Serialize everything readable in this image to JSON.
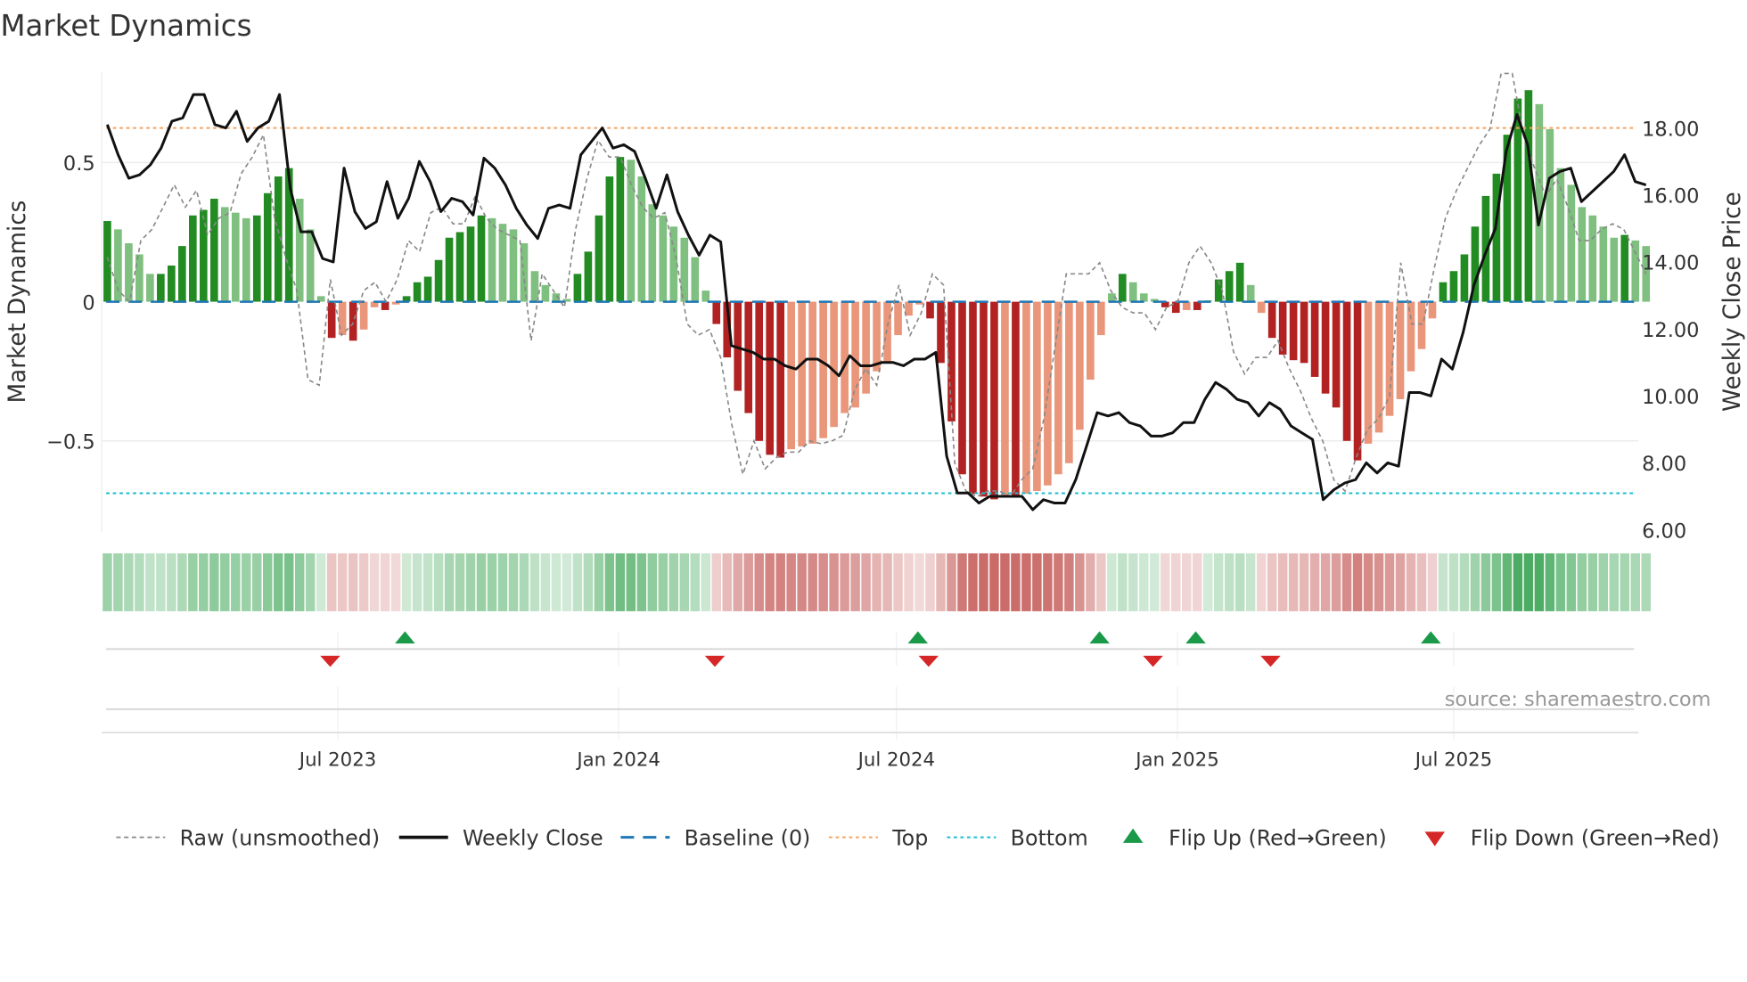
{
  "chart_data": {
    "type": "bar",
    "title": "Market Dynamics",
    "ylabel": "Market Dynamics",
    "y2label": "Weekly Close Price",
    "first_week": "2023-01-31",
    "ylim": [
      -0.828,
      0.824
    ],
    "y2lim": [
      5.93,
      19.66
    ],
    "yticks": [
      {
        "v": 0.5,
        "label": "0.5"
      },
      {
        "v": 0,
        "label": "0"
      },
      {
        "v": -0.5,
        "label": "−0.5"
      }
    ],
    "y2ticks": [
      {
        "v": 18,
        "label": "18.00"
      },
      {
        "v": 16,
        "label": "16.00"
      },
      {
        "v": 14,
        "label": "14.00"
      },
      {
        "v": 12,
        "label": "12.00"
      },
      {
        "v": 10,
        "label": "10.00"
      },
      {
        "v": 8,
        "label": "8.00"
      },
      {
        "v": 6,
        "label": "6.00"
      }
    ],
    "xticks": [
      {
        "date": "2023-07-01",
        "label": "Jul 2023"
      },
      {
        "date": "2024-01-01",
        "label": "Jan 2024"
      },
      {
        "date": "2024-07-01",
        "label": "Jul 2024"
      },
      {
        "date": "2025-01-01",
        "label": "Jan 2025"
      },
      {
        "date": "2025-07-01",
        "label": "Jul 2025"
      }
    ],
    "top_level": 0.624,
    "bottom_level": -0.688,
    "baseline": 0,
    "histogram": [
      0.29,
      0.26,
      0.21,
      0.17,
      0.1,
      0.1,
      0.13,
      0.2,
      0.31,
      0.33,
      0.37,
      0.34,
      0.32,
      0.3,
      0.31,
      0.39,
      0.45,
      0.48,
      0.37,
      0.26,
      0.02,
      -0.13,
      -0.12,
      -0.14,
      -0.1,
      -0.02,
      -0.03,
      -0.01,
      0.02,
      0.07,
      0.09,
      0.15,
      0.23,
      0.25,
      0.27,
      0.31,
      0.3,
      0.28,
      0.26,
      0.21,
      0.11,
      0.06,
      0.03,
      0.01,
      0.1,
      0.18,
      0.31,
      0.45,
      0.52,
      0.51,
      0.45,
      0.35,
      0.31,
      0.27,
      0.23,
      0.16,
      0.04,
      -0.08,
      -0.2,
      -0.32,
      -0.4,
      -0.5,
      -0.55,
      -0.56,
      -0.53,
      -0.52,
      -0.51,
      -0.49,
      -0.45,
      -0.4,
      -0.38,
      -0.33,
      -0.25,
      -0.22,
      -0.12,
      -0.05,
      -0.01,
      -0.06,
      -0.22,
      -0.43,
      -0.62,
      -0.69,
      -0.7,
      -0.71,
      -0.7,
      -0.7,
      -0.69,
      -0.68,
      -0.66,
      -0.62,
      -0.58,
      -0.46,
      -0.28,
      -0.12,
      0.03,
      0.1,
      0.07,
      0.03,
      0.01,
      -0.02,
      -0.04,
      -0.03,
      -0.03,
      0.005,
      0.08,
      0.11,
      0.14,
      0.06,
      -0.04,
      -0.13,
      -0.19,
      -0.21,
      -0.22,
      -0.27,
      -0.33,
      -0.38,
      -0.5,
      -0.57,
      -0.51,
      -0.47,
      -0.41,
      -0.35,
      -0.25,
      -0.17,
      -0.06,
      0.07,
      0.11,
      0.17,
      0.27,
      0.38,
      0.46,
      0.6,
      0.73,
      0.76,
      0.71,
      0.62,
      0.48,
      0.42,
      0.34,
      0.31,
      0.27,
      0.23,
      0.24,
      0.22,
      0.2
    ],
    "raw": [
      0.16,
      0.04,
      0.0,
      0.22,
      0.26,
      0.34,
      0.42,
      0.34,
      0.4,
      0.24,
      0.3,
      0.32,
      0.46,
      0.52,
      0.6,
      0.3,
      0.16,
      0.04,
      -0.28,
      -0.3,
      0.08,
      -0.12,
      -0.08,
      0.04,
      0.07,
      0.0,
      0.08,
      0.22,
      0.18,
      0.32,
      0.34,
      0.28,
      0.28,
      0.38,
      0.3,
      0.26,
      0.24,
      0.22,
      -0.14,
      0.1,
      0.04,
      -0.02,
      0.26,
      0.44,
      0.58,
      0.52,
      0.52,
      0.42,
      0.34,
      0.3,
      0.32,
      0.16,
      -0.08,
      -0.12,
      -0.1,
      -0.2,
      -0.44,
      -0.62,
      -0.5,
      -0.6,
      -0.56,
      -0.54,
      -0.54,
      -0.5,
      -0.51,
      -0.5,
      -0.48,
      -0.32,
      -0.24,
      -0.3,
      -0.08,
      0.06,
      -0.12,
      -0.04,
      0.1,
      0.06,
      -0.58,
      -0.68,
      -0.7,
      -0.68,
      -0.68,
      -0.7,
      -0.64,
      -0.6,
      -0.42,
      -0.16,
      0.1,
      0.1,
      0.1,
      0.14,
      0.04,
      -0.02,
      -0.04,
      -0.04,
      -0.1,
      -0.02,
      0.0,
      0.14,
      0.2,
      0.14,
      0.04,
      -0.18,
      -0.26,
      -0.2,
      -0.2,
      -0.14,
      -0.24,
      -0.32,
      -0.42,
      -0.5,
      -0.64,
      -0.68,
      -0.56,
      -0.46,
      -0.42,
      -0.34,
      0.14,
      -0.08,
      -0.08,
      0.12,
      0.3,
      0.4,
      0.48,
      0.56,
      0.62,
      0.82,
      0.82,
      0.6,
      0.48,
      0.38,
      0.44,
      0.34,
      0.22,
      0.22,
      0.26,
      0.28,
      0.26,
      0.18,
      0.1
    ],
    "close": [
      18.1,
      17.2,
      16.5,
      16.6,
      16.9,
      17.4,
      18.2,
      18.3,
      19.0,
      19.0,
      18.1,
      18.0,
      18.5,
      17.6,
      18.0,
      18.2,
      19.0,
      16.2,
      14.9,
      14.9,
      14.1,
      14.0,
      16.8,
      15.5,
      15.0,
      15.2,
      16.4,
      15.3,
      15.9,
      17.0,
      16.4,
      15.5,
      15.9,
      15.8,
      15.4,
      17.1,
      16.8,
      16.3,
      15.6,
      15.1,
      14.7,
      15.6,
      15.7,
      15.6,
      17.2,
      17.6,
      18.0,
      17.4,
      17.5,
      17.3,
      16.5,
      15.6,
      16.6,
      15.5,
      14.8,
      14.2,
      14.8,
      14.6,
      11.5,
      11.4,
      11.3,
      11.1,
      11.1,
      10.9,
      10.8,
      11.1,
      11.1,
      10.9,
      10.6,
      11.2,
      10.9,
      10.9,
      11.0,
      11.0,
      10.9,
      11.1,
      11.1,
      11.3,
      8.2,
      7.1,
      7.1,
      6.8,
      7.0,
      7.0,
      7.0,
      7.0,
      6.6,
      6.9,
      6.8,
      6.8,
      7.5,
      8.5,
      9.5,
      9.4,
      9.5,
      9.2,
      9.1,
      8.8,
      8.8,
      8.9,
      9.2,
      9.2,
      9.9,
      10.4,
      10.2,
      9.9,
      9.8,
      9.4,
      9.8,
      9.6,
      9.1,
      8.9,
      8.7,
      6.9,
      7.2,
      7.4,
      7.5,
      8.0,
      7.7,
      8.0,
      7.9,
      10.1,
      10.1,
      10.0,
      11.1,
      10.8,
      11.9,
      13.3,
      14.2,
      15.0,
      17.3,
      18.4,
      17.5,
      15.1,
      16.5,
      16.7,
      16.8,
      15.8,
      16.1,
      16.4,
      16.7,
      17.2,
      16.4,
      16.3
    ],
    "flips_up": [
      "2023-08-14",
      "2024-07-15",
      "2024-11-11",
      "2025-01-13",
      "2025-06-16"
    ],
    "flips_down": [
      "2023-06-26",
      "2024-03-04",
      "2024-07-22",
      "2024-12-16",
      "2025-03-03"
    ],
    "legend": {
      "raw": "Raw (unsmoothed)",
      "close": "Weekly Close",
      "baseline": "Baseline (0)",
      "top": "Top",
      "bottom": "Bottom",
      "flip_up": "Flip Up (Red→Green)",
      "flip_down": "Flip Down (Green→Red)"
    },
    "source": "source: sharemaestro.com",
    "colors": {
      "up_strong": "#228b22",
      "up_weak": "#7fbf7f",
      "down_strong": "#b22222",
      "down_weak": "#e9967a",
      "raw": "#888888",
      "close": "#111111",
      "baseline": "#1f77b4",
      "top": "#f4a460",
      "bottom": "#17becf",
      "flip_up": "#1a9a48",
      "flip_down": "#d62728",
      "heat_green": "#2e9e48",
      "heat_red": "#c0504d"
    }
  }
}
